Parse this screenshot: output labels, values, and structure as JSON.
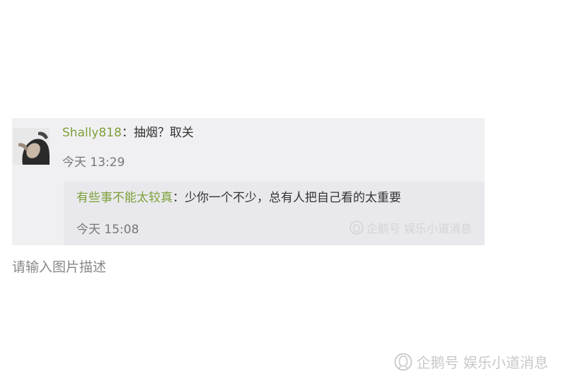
{
  "comment": {
    "username": "Shally818",
    "separator": "：",
    "text": "抽烟？取关",
    "time": "今天 13:29",
    "avatar_icon": "user-avatar-photo"
  },
  "reply": {
    "username": "有些事不能太较真",
    "separator": "：",
    "text": "少你一个不少，总有人把自己看的太重要",
    "time": "今天 15:08",
    "watermark": "企鹅号 娱乐小道消息"
  },
  "caption": "请输入图片描述",
  "watermark": {
    "text": "企鹅号 娱乐小道消息",
    "logo_icon": "penguin-logo-icon"
  },
  "colors": {
    "username": "#7ea03a",
    "card_bg": "#f0f0f3",
    "reply_bg": "#e9e9ed"
  }
}
